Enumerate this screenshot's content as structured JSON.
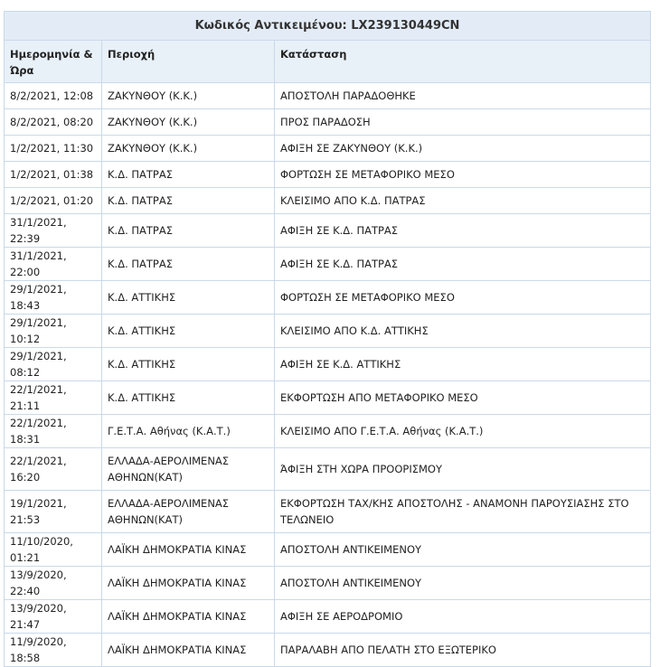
{
  "caption": "Κωδικός Αντικειμένου: LX239130449CN",
  "columns": [
    "Ημερομηνία & Ώρα",
    "Περιοχή",
    "Κατάσταση"
  ],
  "rows": [
    {
      "date": "8/2/2021, 12:08",
      "area": "ΖΑΚΥΝΘΟΥ (Κ.Κ.)",
      "status": "ΑΠΟΣΤΟΛΗ ΠΑΡΑΔΟΘΗΚΕ"
    },
    {
      "date": "8/2/2021, 08:20",
      "area": "ΖΑΚΥΝΘΟΥ (Κ.Κ.)",
      "status": "ΠΡΟΣ ΠΑΡΑΔΟΣΗ"
    },
    {
      "date": "1/2/2021, 11:30",
      "area": "ΖΑΚΥΝΘΟΥ (Κ.Κ.)",
      "status": "ΑΦΙΞΗ ΣΕ ΖΑΚΥΝΘΟΥ (Κ.Κ.)"
    },
    {
      "date": "1/2/2021, 01:38",
      "area": "Κ.Δ. ΠΑΤΡΑΣ",
      "status": "ΦΟΡΤΩΣΗ ΣΕ ΜΕΤΑΦΟΡΙΚΟ ΜΕΣΟ"
    },
    {
      "date": "1/2/2021, 01:20",
      "area": "Κ.Δ. ΠΑΤΡΑΣ",
      "status": "ΚΛΕΙΣΙΜΟ ΑΠΟ Κ.Δ. ΠΑΤΡΑΣ"
    },
    {
      "date": "31/1/2021, 22:39",
      "area": "Κ.Δ. ΠΑΤΡΑΣ",
      "status": "ΑΦΙΞΗ ΣΕ Κ.Δ. ΠΑΤΡΑΣ"
    },
    {
      "date": "31/1/2021, 22:00",
      "area": "Κ.Δ. ΠΑΤΡΑΣ",
      "status": "ΑΦΙΞΗ ΣΕ Κ.Δ. ΠΑΤΡΑΣ"
    },
    {
      "date": "29/1/2021, 18:43",
      "area": "Κ.Δ. ΑΤΤΙΚΗΣ",
      "status": "ΦΟΡΤΩΣΗ ΣΕ ΜΕΤΑΦΟΡΙΚΟ ΜΕΣΟ"
    },
    {
      "date": "29/1/2021, 10:12",
      "area": "Κ.Δ. ΑΤΤΙΚΗΣ",
      "status": "ΚΛΕΙΣΙΜΟ ΑΠΟ Κ.Δ. ΑΤΤΙΚΗΣ"
    },
    {
      "date": "29/1/2021, 08:12",
      "area": "Κ.Δ. ΑΤΤΙΚΗΣ",
      "status": "ΑΦΙΞΗ ΣΕ Κ.Δ. ΑΤΤΙΚΗΣ"
    },
    {
      "date": "22/1/2021, 21:11",
      "area": "Κ.Δ. ΑΤΤΙΚΗΣ",
      "status": "ΕΚΦΟΡΤΩΣΗ ΑΠΟ ΜΕΤΑΦΟΡΙΚΟ ΜΕΣΟ"
    },
    {
      "date": "22/1/2021, 18:31",
      "area": "Γ.Ε.Τ.Α. Αθήνας (Κ.Α.Τ.)",
      "status": "ΚΛΕΙΣΙΜΟ ΑΠΟ Γ.Ε.Τ.Α. Αθήνας (Κ.Α.Τ.)"
    },
    {
      "date": "22/1/2021, 16:20",
      "area": "ΕΛΛΑΔΑ-ΑΕΡΟΛΙΜΕΝΑΣ ΑΘΗΝΩΝ(ΚΑΤ)",
      "status": "ΆΦΙΞΗ ΣΤΗ ΧΩΡΑ ΠΡΟΟΡΙΣΜΟΥ"
    },
    {
      "date": "19/1/2021, 21:53",
      "area": "ΕΛΛΑΔΑ-ΑΕΡΟΛΙΜΕΝΑΣ ΑΘΗΝΩΝ(ΚΑΤ)",
      "status": "ΕΚΦΟΡΤΩΣΗ ΤΑΧ/ΚΗΣ ΑΠΟΣΤΟΛΗΣ - ΑΝΑΜΟΝΗ ΠΑΡΟΥΣΙΑΣΗΣ ΣΤΟ ΤΕΛΩΝΕΙΟ"
    },
    {
      "date": "11/10/2020, 01:21",
      "area": "ΛΑΪΚΗ ΔΗΜΟΚΡΑΤΙΑ ΚΙΝΑΣ",
      "status": "ΑΠΟΣΤΟΛΗ ΑΝΤΙΚΕΙΜΕΝΟΥ"
    },
    {
      "date": "13/9/2020, 22:40",
      "area": "ΛΑΪΚΗ ΔΗΜΟΚΡΑΤΙΑ ΚΙΝΑΣ",
      "status": "ΑΠΟΣΤΟΛΗ ΑΝΤΙΚΕΙΜΕΝΟΥ"
    },
    {
      "date": "13/9/2020, 21:47",
      "area": "ΛΑΪΚΗ ΔΗΜΟΚΡΑΤΙΑ ΚΙΝΑΣ",
      "status": "ΑΦΙΞΗ ΣΕ ΑΕΡΟΔΡΟΜΙΟ"
    },
    {
      "date": "11/9/2020, 18:58",
      "area": "ΛΑΪΚΗ ΔΗΜΟΚΡΑΤΙΑ ΚΙΝΑΣ",
      "status": "ΠΑΡΑΛΑΒΗ ΑΠΟ ΠΕΛΑΤΗ ΣΤΟ ΕΞΩΤΕΡΙΚΟ"
    }
  ]
}
